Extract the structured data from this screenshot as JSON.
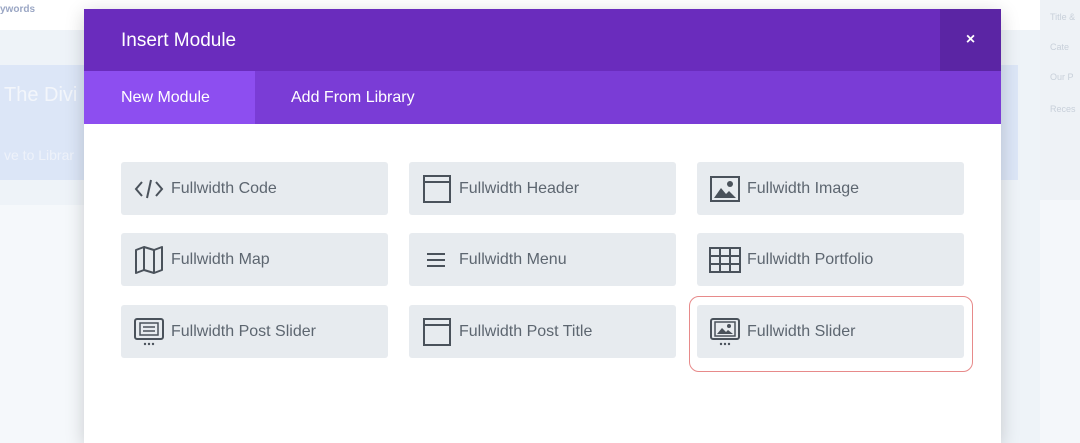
{
  "background": {
    "topbar_text": "ywords",
    "hero_title": "The Divi",
    "hero_sub": "ve to Librar",
    "right_col_texts": [
      "Title &",
      "Cate",
      "Our P",
      "Reces"
    ]
  },
  "modal": {
    "title": "Insert Module",
    "close_label": "×",
    "tabs": [
      {
        "label": "New Module",
        "active": true
      },
      {
        "label": "Add From Library",
        "active": false
      }
    ],
    "modules": [
      {
        "label": "Fullwidth Code",
        "icon": "code-icon"
      },
      {
        "label": "Fullwidth Header",
        "icon": "header-icon"
      },
      {
        "label": "Fullwidth Image",
        "icon": "image-icon"
      },
      {
        "label": "Fullwidth Map",
        "icon": "map-icon"
      },
      {
        "label": "Fullwidth Menu",
        "icon": "menu-icon"
      },
      {
        "label": "Fullwidth Portfolio",
        "icon": "grid-icon"
      },
      {
        "label": "Fullwidth Post Slider",
        "icon": "post-slider-icon"
      },
      {
        "label": "Fullwidth Post Title",
        "icon": "post-title-icon"
      },
      {
        "label": "Fullwidth Slider",
        "icon": "slider-icon",
        "highlighted": true
      }
    ]
  },
  "colors": {
    "header": "#6a2cbd",
    "tabs_bar": "#7a3cd6",
    "active_tab": "#8d4ef0",
    "module_bg": "#e7ebef",
    "module_text": "#5d6670",
    "highlight_outline": "#e78a8a"
  }
}
